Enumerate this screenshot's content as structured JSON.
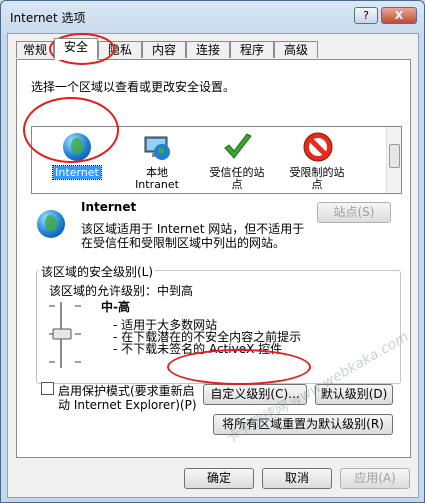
{
  "window": {
    "title": "Internet 选项",
    "help_label": "?",
    "close_label": "X"
  },
  "tabs": [
    {
      "label": "常规"
    },
    {
      "label": "安全"
    },
    {
      "label": "隐私"
    },
    {
      "label": "内容"
    },
    {
      "label": "连接"
    },
    {
      "label": "程序"
    },
    {
      "label": "高级"
    }
  ],
  "security": {
    "prompt": "选择一个区域以查看或更改安全设置。",
    "zones": [
      {
        "label": "Internet",
        "selected": true
      },
      {
        "label": "本地\nIntranet"
      },
      {
        "label": "受信任的站\n点"
      },
      {
        "label": "受限制的站\n点"
      }
    ],
    "zone_name": "Internet",
    "zone_desc_line1": "该区域适用于 Internet 网站，但不适用于",
    "zone_desc_line2": "在受信任和受限制区域中列出的网站。",
    "sites_button": "站点(S)",
    "group_title": "该区域的安全级别(L)",
    "allowed_levels": "该区域的允许级别：中到高",
    "level_name": "中-高",
    "level_bullets": [
      "- 适用于大多数网站",
      "- 在下载潜在的不安全内容之前提示",
      "- 不下载未签名的 ActiveX 控件"
    ],
    "protected_mode_line1": "启用保护模式(要求重新启",
    "protected_mode_line2": "动 Internet Explorer)(P)",
    "protected_mode_checked": false,
    "custom_level_button": "自定义级别(C)...",
    "default_level_button": "默认级别(D)",
    "reset_all_button": "将所有区域重置为默认级别(R)"
  },
  "footer": {
    "ok_label": "确定",
    "cancel_label": "取消",
    "apply_label": "应用(A)"
  },
  "watermark": "卡卡测速网 www.webkaka.com",
  "colors": {
    "annotation_red": "#e0201a",
    "selection_blue": "#3399ff"
  }
}
